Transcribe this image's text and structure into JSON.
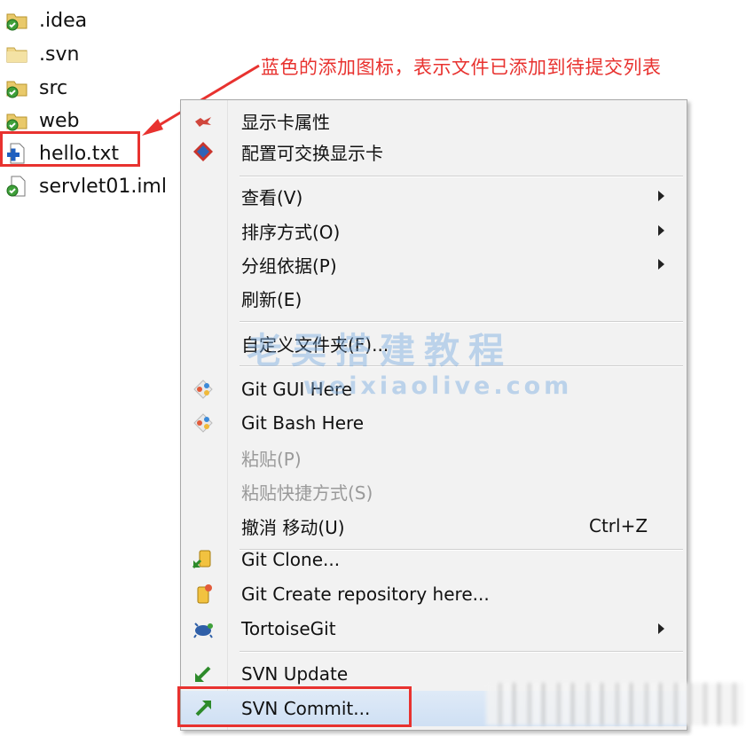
{
  "files": [
    {
      "name": ".idea",
      "icon": "svn-folder-icon"
    },
    {
      "name": ".svn",
      "icon": "folder-icon"
    },
    {
      "name": "src",
      "icon": "svn-folder-icon"
    },
    {
      "name": "web",
      "icon": "svn-folder-icon"
    },
    {
      "name": "hello.txt",
      "icon": "svn-added-file-icon"
    },
    {
      "name": "servlet01.iml",
      "icon": "svn-file-icon"
    }
  ],
  "annotation": {
    "text": "蓝色的添加图标，表示文件已添加到待提交列表",
    "color": "#e8322f"
  },
  "context_menu": {
    "items": [
      {
        "label": "显示卡属性",
        "icon": "display-properties-icon"
      },
      {
        "label": "配置可交换显示卡",
        "icon": "switchable-graphics-icon"
      },
      {
        "label": "查看(V)",
        "submenu": true
      },
      {
        "label": "排序方式(O)",
        "submenu": true
      },
      {
        "label": "分组依据(P)",
        "submenu": true
      },
      {
        "label": "刷新(E)"
      },
      {
        "label": "自定义文件夹(F)..."
      },
      {
        "label": "Git GUI Here",
        "icon": "git-gui-icon"
      },
      {
        "label": "Git Bash Here",
        "icon": "git-bash-icon"
      },
      {
        "label": "粘贴(P)",
        "disabled": true
      },
      {
        "label": "粘贴快捷方式(S)",
        "disabled": true
      },
      {
        "label": "撤消 移动(U)",
        "shortcut": "Ctrl+Z"
      },
      {
        "label": "Git Clone...",
        "icon": "git-clone-icon"
      },
      {
        "label": "Git Create repository here...",
        "icon": "git-create-repo-icon"
      },
      {
        "label": "TortoiseGit",
        "icon": "tortoisegit-icon",
        "submenu": true
      },
      {
        "label": "SVN Update",
        "icon": "svn-update-icon"
      },
      {
        "label": "SVN Commit...",
        "icon": "svn-commit-icon",
        "hovered": true
      }
    ]
  },
  "watermark": {
    "line1": "老吴搭建教程",
    "line2": "weixiaolive.com"
  },
  "colors": {
    "highlight_red": "#e8322f",
    "menu_background": "#f2f2f2",
    "hover_blue": "#cfe0f4"
  }
}
